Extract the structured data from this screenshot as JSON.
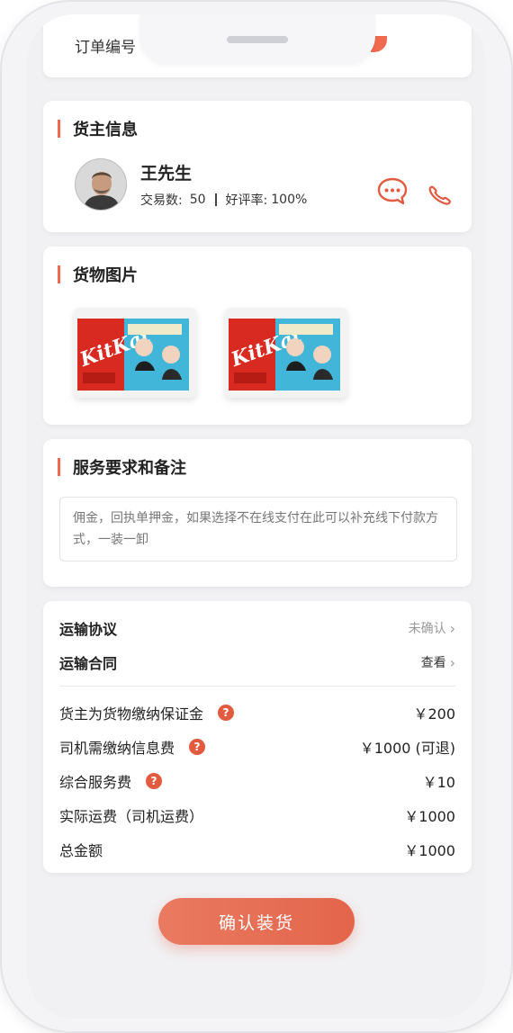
{
  "order": {
    "label": "订单编号"
  },
  "shipper": {
    "title": "货主信息",
    "name": "王先生",
    "trades_label": "交易数:",
    "trades_value": "50",
    "rating_label": "好评率:",
    "rating_value": "100%",
    "icons": [
      "chat-icon",
      "phone-icon"
    ]
  },
  "images": {
    "title": "货物图片"
  },
  "notes": {
    "title": "服务要求和备注",
    "text": "佣金，回执单押金，如果选择不在线支付在此可以补充线下付款方式，一装一卸"
  },
  "fees": {
    "rows": [
      {
        "label": "运输协议",
        "value": "未确认",
        "chevron": "›"
      },
      {
        "label": "运输合同",
        "value": "查看",
        "chevron": "›"
      },
      {
        "label": "货主为货物缴纳保证金",
        "value": "￥200",
        "help": "?"
      },
      {
        "label": "司机需缴纳信息费",
        "value": "￥1000 (可退)",
        "help": "?"
      },
      {
        "label": "综合服务费",
        "value": "￥10",
        "help": "?"
      },
      {
        "label": "实际运费（司机运费）",
        "value": "￥1000"
      },
      {
        "label": "总金额",
        "value": "￥1000"
      }
    ]
  },
  "actions": {
    "confirm_label": "确认装货"
  },
  "colors": {
    "accent": "#ef6a4f",
    "button": "#e3654b"
  }
}
